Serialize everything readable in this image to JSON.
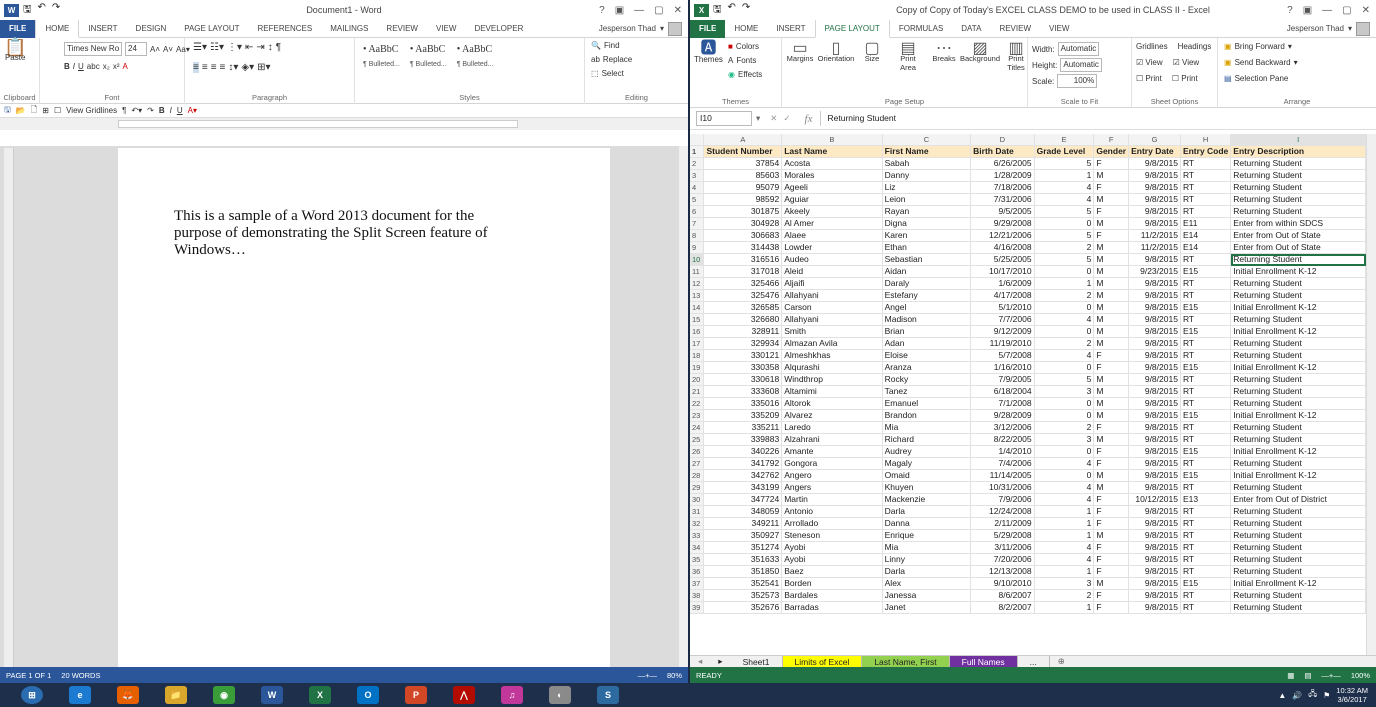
{
  "word": {
    "title": "Document1 - Word",
    "tabs": [
      "FILE",
      "HOME",
      "INSERT",
      "DESIGN",
      "PAGE LAYOUT",
      "REFERENCES",
      "MAILINGS",
      "REVIEW",
      "VIEW",
      "DEVELOPER"
    ],
    "user": "Jesperson Thad",
    "ribbon": {
      "font_name": "Times New Ro",
      "font_size": "24",
      "groups": [
        "Clipboard",
        "Font",
        "Paragraph",
        "Styles",
        "Editing"
      ],
      "paste": "Paste",
      "styles": [
        {
          "sample": "• AaBbC",
          "name": "¶ Bulleted..."
        },
        {
          "sample": "• AaBbC",
          "name": "¶ Bulleted..."
        },
        {
          "sample": "• AaBbC",
          "name": "¶ Bulleted..."
        }
      ],
      "find": "Find",
      "replace": "Replace",
      "select": "Select"
    },
    "view_gridlines": "View Gridlines",
    "body_text": "This is a sample of a Word 2013 document for the purpose of demonstrating the Split Screen feature of Windows…",
    "status": {
      "page": "PAGE 1 OF 1",
      "words": "20 WORDS",
      "zoom": "80%"
    }
  },
  "excel": {
    "title": "Copy of Copy of Today's EXCEL CLASS DEMO to be used in CLASS II - Excel",
    "tabs": [
      "FILE",
      "HOME",
      "INSERT",
      "PAGE LAYOUT",
      "FORMULAS",
      "DATA",
      "REVIEW",
      "VIEW"
    ],
    "user": "Jesperson Thad",
    "ribbon": {
      "themes": "Themes",
      "colors": "Colors",
      "fonts": "Fonts",
      "effects": "Effects",
      "page_setup": [
        "Margins",
        "Orientation",
        "Size",
        "Print Area",
        "Breaks",
        "Background",
        "Print Titles"
      ],
      "width_label": "Width:",
      "width_value": "Automatic",
      "height_label": "Height:",
      "height_value": "Automatic",
      "scale_label": "Scale:",
      "scale_value": "100%",
      "gridlines": "Gridlines",
      "headings": "Headings",
      "view": "View",
      "print": "Print",
      "bring_forward": "Bring Forward",
      "send_backward": "Send Backward",
      "selection_pane": "Selection Pane",
      "groups": [
        "Themes",
        "Page Setup",
        "Scale to Fit",
        "Sheet Options",
        "Arrange"
      ]
    },
    "name_box": "I10",
    "formula_value": "Returning Student",
    "columns": [
      "A",
      "B",
      "C",
      "D",
      "E",
      "F",
      "G",
      "H",
      "I"
    ],
    "header_row": [
      "Student Number",
      "Last Name",
      "First Name",
      "Birth Date",
      "Grade Level",
      "Gender",
      "Entry Date",
      "Entry Code",
      "Entry Description"
    ],
    "rows": [
      [
        "37854",
        "Acosta",
        "Sabah",
        "6/26/2005",
        "5",
        "F",
        "9/8/2015",
        "RT",
        "Returning Student"
      ],
      [
        "85603",
        "Morales",
        "Danny",
        "1/28/2009",
        "1",
        "M",
        "9/8/2015",
        "RT",
        "Returning Student"
      ],
      [
        "95079",
        "Ageeli",
        "Liz",
        "7/18/2006",
        "4",
        "F",
        "9/8/2015",
        "RT",
        "Returning Student"
      ],
      [
        "98592",
        "Aguiar",
        "Leion",
        "7/31/2006",
        "4",
        "M",
        "9/8/2015",
        "RT",
        "Returning Student"
      ],
      [
        "301875",
        "Akeely",
        "Rayan",
        "9/5/2005",
        "5",
        "F",
        "9/8/2015",
        "RT",
        "Returning Student"
      ],
      [
        "304928",
        "Al Amer",
        "Digna",
        "9/29/2008",
        "0",
        "M",
        "9/8/2015",
        "E11",
        "Enter from within SDCS"
      ],
      [
        "306683",
        "Alaee",
        "Karen",
        "12/21/2006",
        "5",
        "F",
        "11/2/2015",
        "E14",
        "Enter from Out of State"
      ],
      [
        "314438",
        "Lowder",
        "Ethan",
        "4/16/2008",
        "2",
        "M",
        "11/2/2015",
        "E14",
        "Enter from Out of State"
      ],
      [
        "316516",
        "Audeo",
        "Sebastian",
        "5/25/2005",
        "5",
        "M",
        "9/8/2015",
        "RT",
        "Returning Student"
      ],
      [
        "317018",
        "Aleid",
        "Aidan",
        "10/17/2010",
        "0",
        "M",
        "9/23/2015",
        "E15",
        "Initial Enrollment K-12"
      ],
      [
        "325466",
        "Aljaifi",
        "Daraly",
        "1/6/2009",
        "1",
        "M",
        "9/8/2015",
        "RT",
        "Returning Student"
      ],
      [
        "325476",
        "Allahyani",
        "Estefany",
        "4/17/2008",
        "2",
        "M",
        "9/8/2015",
        "RT",
        "Returning Student"
      ],
      [
        "326585",
        "Carson",
        "Angel",
        "5/1/2010",
        "0",
        "M",
        "9/8/2015",
        "E15",
        "Initial Enrollment K-12"
      ],
      [
        "326680",
        "Allahyani",
        "Madison",
        "7/7/2006",
        "4",
        "M",
        "9/8/2015",
        "RT",
        "Returning Student"
      ],
      [
        "328911",
        "Smith",
        "Brian",
        "9/12/2009",
        "0",
        "M",
        "9/8/2015",
        "E15",
        "Initial Enrollment K-12"
      ],
      [
        "329934",
        "Almazan Avila",
        "Adan",
        "11/19/2010",
        "2",
        "M",
        "9/8/2015",
        "RT",
        "Returning Student"
      ],
      [
        "330121",
        "Almeshkhas",
        "Eloise",
        "5/7/2008",
        "4",
        "F",
        "9/8/2015",
        "RT",
        "Returning Student"
      ],
      [
        "330358",
        "Alqurashi",
        "Aranza",
        "1/16/2010",
        "0",
        "F",
        "9/8/2015",
        "E15",
        "Initial Enrollment K-12"
      ],
      [
        "330618",
        "Windthrop",
        "Rocky",
        "7/9/2005",
        "5",
        "M",
        "9/8/2015",
        "RT",
        "Returning Student"
      ],
      [
        "333608",
        "Altamimi",
        "Tanez",
        "6/18/2004",
        "3",
        "M",
        "9/8/2015",
        "RT",
        "Returning Student"
      ],
      [
        "335016",
        "Altorok",
        "Emanuel",
        "7/1/2008",
        "0",
        "M",
        "9/8/2015",
        "RT",
        "Returning Student"
      ],
      [
        "335209",
        "Alvarez",
        "Brandon",
        "9/28/2009",
        "0",
        "M",
        "9/8/2015",
        "E15",
        "Initial Enrollment K-12"
      ],
      [
        "335211",
        "Laredo",
        "Mia",
        "3/12/2006",
        "2",
        "F",
        "9/8/2015",
        "RT",
        "Returning Student"
      ],
      [
        "339883",
        "Alzahrani",
        "Richard",
        "8/22/2005",
        "3",
        "M",
        "9/8/2015",
        "RT",
        "Returning Student"
      ],
      [
        "340226",
        "Amante",
        "Audrey",
        "1/4/2010",
        "0",
        "F",
        "9/8/2015",
        "E15",
        "Initial Enrollment K-12"
      ],
      [
        "341792",
        "Gongora",
        "Magaly",
        "7/4/2006",
        "4",
        "F",
        "9/8/2015",
        "RT",
        "Returning Student"
      ],
      [
        "342762",
        "Angero",
        "Omaid",
        "11/14/2005",
        "0",
        "M",
        "9/8/2015",
        "E15",
        "Initial Enrollment K-12"
      ],
      [
        "343199",
        "Angers",
        "Khuyen",
        "10/31/2006",
        "4",
        "M",
        "9/8/2015",
        "RT",
        "Returning Student"
      ],
      [
        "347724",
        "Martin",
        "Mackenzie",
        "7/9/2006",
        "4",
        "F",
        "10/12/2015",
        "E13",
        "Enter from Out of District"
      ],
      [
        "348059",
        "Antonio",
        "Darla",
        "12/24/2008",
        "1",
        "F",
        "9/8/2015",
        "RT",
        "Returning Student"
      ],
      [
        "349211",
        "Arrollado",
        "Danna",
        "2/11/2009",
        "1",
        "F",
        "9/8/2015",
        "RT",
        "Returning Student"
      ],
      [
        "350927",
        "Steneson",
        "Enrique",
        "5/29/2008",
        "1",
        "M",
        "9/8/2015",
        "RT",
        "Returning Student"
      ],
      [
        "351274",
        "Ayobi",
        "Mia",
        "3/11/2006",
        "4",
        "F",
        "9/8/2015",
        "RT",
        "Returning Student"
      ],
      [
        "351633",
        "Ayobi",
        "Linny",
        "7/20/2006",
        "4",
        "F",
        "9/8/2015",
        "RT",
        "Returning Student"
      ],
      [
        "351850",
        "Baez",
        "Darla",
        "12/13/2008",
        "1",
        "F",
        "9/8/2015",
        "RT",
        "Returning Student"
      ],
      [
        "352541",
        "Borden",
        "Alex",
        "9/10/2010",
        "3",
        "M",
        "9/8/2015",
        "E15",
        "Initial Enrollment K-12"
      ],
      [
        "352573",
        "Bardales",
        "Janessa",
        "8/6/2007",
        "2",
        "F",
        "9/8/2015",
        "RT",
        "Returning Student"
      ],
      [
        "352676",
        "Barradas",
        "Janet",
        "8/2/2007",
        "1",
        "F",
        "9/8/2015",
        "RT",
        "Returning Student"
      ]
    ],
    "sheet_tabs": [
      {
        "label": "Sheet1",
        "color": "#f0f0f0"
      },
      {
        "label": "Limits of Excel",
        "color": "#ffff00"
      },
      {
        "label": "Last Name, First",
        "color": "#92d050"
      },
      {
        "label": "Full Names",
        "color": "#7030a0"
      },
      {
        "label": "...",
        "color": "#f0f0f0"
      }
    ],
    "status": {
      "ready": "READY",
      "zoom": "100%"
    }
  },
  "taskbar": {
    "time": "10:32 AM",
    "date": "3/6/2017",
    "apps": [
      "start",
      "ie",
      "firefox",
      "explorer",
      "chrome",
      "word",
      "excel",
      "outlook",
      "powerpoint",
      "acrobat",
      "itunes",
      "paint",
      "snagit"
    ]
  },
  "colors": {
    "word_blue": "#2b579a",
    "excel_green": "#217346"
  }
}
